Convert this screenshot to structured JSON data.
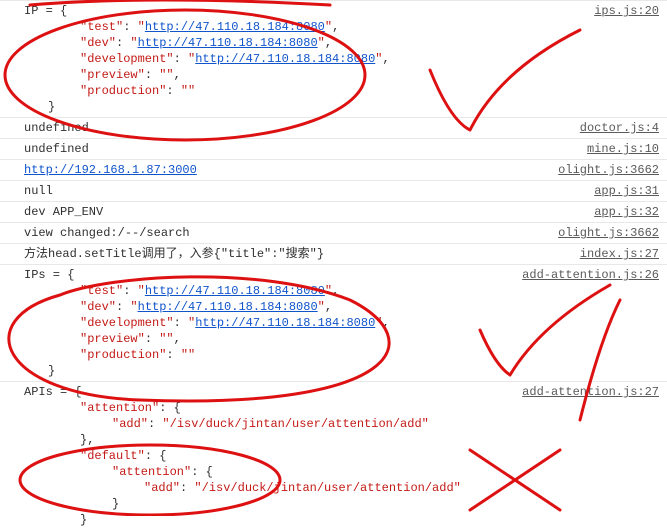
{
  "rows": [
    {
      "link": "ips.js:20",
      "pre": "IP = {",
      "props": [
        {
          "key": "test",
          "url": "http://47.110.18.184:8080"
        },
        {
          "key": "dev",
          "url": "http://47.110.18.184:8080"
        },
        {
          "key": "development",
          "url": "http://47.110.18.184:8080"
        },
        {
          "key": "preview",
          "val": ""
        },
        {
          "key": "production",
          "val": ""
        }
      ]
    },
    {
      "text": "undefined",
      "link": "doctor.js:4"
    },
    {
      "text": "undefined",
      "link": "mine.js:10"
    },
    {
      "url_text": "http://192.168.1.87:3000",
      "link": "olight.js:3662"
    },
    {
      "text": "null",
      "link": "app.js:31"
    },
    {
      "text": "dev APP_ENV",
      "link": "app.js:32"
    },
    {
      "text": "view changed:/--/search",
      "link": "olight.js:3662"
    },
    {
      "text": "方法head.setTitle调用了，入参{\"title\":\"搜索\"}",
      "link": "index.js:27"
    },
    {
      "link": "add-attention.js:26",
      "pre": "IPs = {",
      "props": [
        {
          "key": "test",
          "url": "http://47.110.18.184:8080"
        },
        {
          "key": "dev",
          "url": "http://47.110.18.184:8080"
        },
        {
          "key": "development",
          "url": "http://47.110.18.184:8080"
        },
        {
          "key": "preview",
          "val": ""
        },
        {
          "key": "production",
          "val": ""
        }
      ]
    },
    {
      "link": "add-attention.js:27",
      "apis": {
        "pre": "APIs = {",
        "attention_key": "attention",
        "add_key": "add",
        "add_path": "/isv/duck/jintan/user/attention/add",
        "default_key": "default",
        "inner_att_key": "attention",
        "inner_add_key": "add",
        "inner_add_path": "/isv/duck/jintan/user/attention/add"
      }
    }
  ],
  "labels": {
    "quote": "\"",
    "colon": ": ",
    "comma": ",",
    "obrace": "{",
    "cbrace": "}"
  }
}
